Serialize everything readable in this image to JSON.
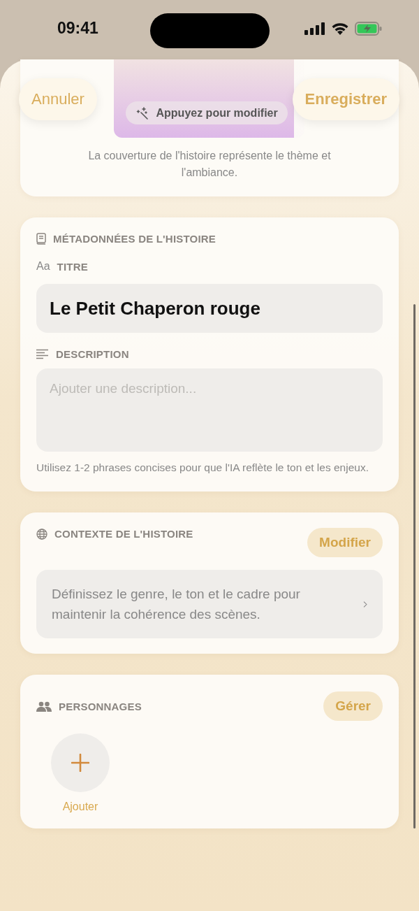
{
  "status_bar": {
    "time": "09:41"
  },
  "nav": {
    "cancel": "Annuler",
    "save": "Enregistrer"
  },
  "cover": {
    "hint": "Appuyez pour modifier",
    "caption": "La couverture de l'histoire représente le thème et l'ambiance."
  },
  "metadata": {
    "heading": "MÉTADONNÉES DE L'HISTOIRE",
    "title_icon": "Aa",
    "title_label": "TITRE",
    "title_value": "Le Petit Chaperon rouge",
    "description_label": "DESCRIPTION",
    "description_placeholder": "Ajouter une description...",
    "help": "Utilisez 1-2 phrases concises pour que l'IA reflète le ton et les enjeux."
  },
  "context": {
    "heading": "CONTEXTE DE L'HISTOIRE",
    "button": "Modifier",
    "summary": "Définissez le genre, le ton et le cadre pour maintenir la cohérence des scènes."
  },
  "characters": {
    "heading": "PERSONNAGES",
    "button": "Gérer",
    "add_label": "Ajouter"
  }
}
